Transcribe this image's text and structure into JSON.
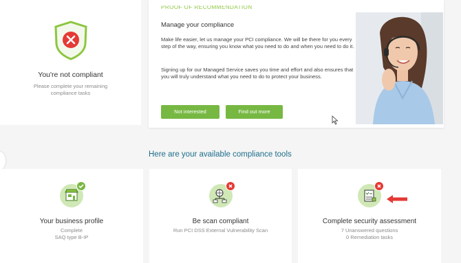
{
  "status": {
    "title": "You're not compliant",
    "subtitle": "Please complete your remaining compliance tasks",
    "icon": "shield-x-icon",
    "color": "#e53935"
  },
  "promo": {
    "cut_heading": "PROOF OF RECOMMENDATION",
    "title": "Manage your compliance",
    "paragraph_1": "Make life easier, let us manage your PCI compliance. We will be there for you every step of the way, ensuring you know what you need to do and when you need to do it.",
    "paragraph_2": "Signing up for our Managed Service saves you time and effort and also ensures that you will truly understand what you need to do to protect your business.",
    "button_not_interested": "Not interested",
    "button_find_out_more": "Find out more",
    "button_color": "#77b843"
  },
  "tools_heading": "Here are your available compliance tools",
  "tools": [
    {
      "title": "Your business profile",
      "line1": "Complete",
      "line2": "SAQ type B-IP",
      "icon": "store-icon",
      "status": "complete"
    },
    {
      "title": "Be scan compliant",
      "line1": "Run PCI DSS External Vulnerability Scan",
      "line2": "",
      "icon": "network-scan-icon",
      "status": "incomplete"
    },
    {
      "title": "Complete security assessment",
      "line1": "7 Unanswered questions",
      "line2": "0 Remediation tasks",
      "icon": "checklist-icon",
      "status": "incomplete"
    }
  ],
  "colors": {
    "accent_green": "#77b843",
    "error_red": "#e53935",
    "heading_blue": "#1f6d8c"
  }
}
